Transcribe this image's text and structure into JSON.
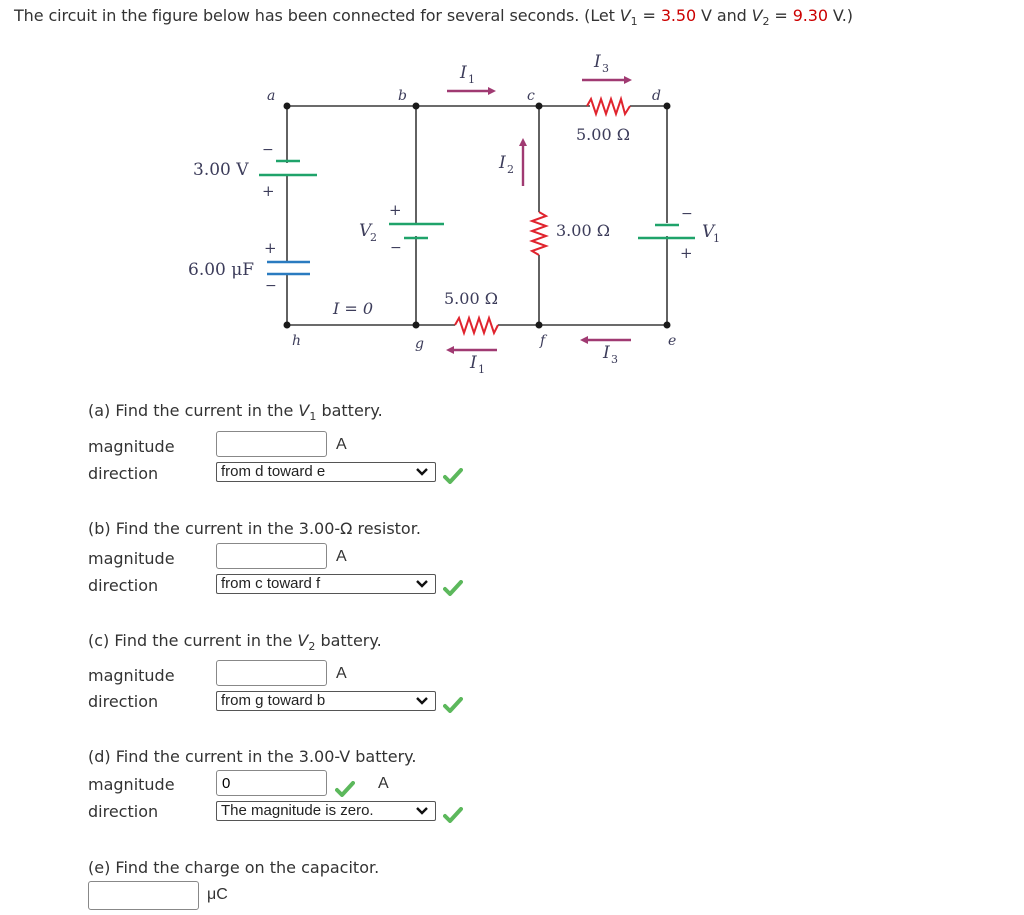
{
  "intro": {
    "text_before": "The circuit in the figure below has been connected for several seconds. (Let ",
    "v1_symbol": "V",
    "v1_sub": "1",
    "eq1": " = ",
    "v1_value": "3.50",
    "unit1": " V and ",
    "v2_symbol": "V",
    "v2_sub": "2",
    "eq2": " = ",
    "v2_value": "9.30",
    "unit2": " V.)"
  },
  "colors": {
    "given_value": "#cc0000",
    "wire": "#3a3a3a",
    "battery": "#1fa36a",
    "capacitor": "#2a7bc0",
    "resistor": "#e0242e",
    "current_arrow": "#a03a72",
    "check": "#5cb85c"
  },
  "circuit": {
    "nodes": [
      "a",
      "b",
      "c",
      "d",
      "e",
      "f",
      "g",
      "h"
    ],
    "battery_3v": "3.00 V",
    "capacitor": "6.00 μF",
    "v2_label": "V",
    "v2_sub": "2",
    "v1_label": "V",
    "v1_sub": "1",
    "r_top": "5.00 Ω",
    "r_middle": "3.00 Ω",
    "r_bottom": "5.00 Ω",
    "i_zero": "I = 0",
    "current_label": "I",
    "i1_sub": "1",
    "i2_sub": "2",
    "i3_sub": "3",
    "plus": "+",
    "minus": "−"
  },
  "questions": [
    {
      "prefix": "(a) Find the current in the ",
      "sym": "V",
      "sub": "1",
      "suffix": " battery.",
      "magnitude_label": "magnitude",
      "magnitude_value": "",
      "unit": "A",
      "direction_label": "direction",
      "direction_value": "from d toward e",
      "direction_correct": true
    },
    {
      "prefix": "(b) Find the current in the 3.00-Ω resistor.",
      "magnitude_label": "magnitude",
      "magnitude_value": "",
      "unit": "A",
      "direction_label": "direction",
      "direction_value": "from c toward f",
      "direction_correct": true
    },
    {
      "prefix": "(c) Find the current in the ",
      "sym": "V",
      "sub": "2",
      "suffix": " battery.",
      "magnitude_label": "magnitude",
      "magnitude_value": "",
      "unit": "A",
      "direction_label": "direction",
      "direction_value": "from g toward b",
      "direction_correct": true
    },
    {
      "prefix": "(d) Find the current in the 3.00-V battery.",
      "magnitude_label": "magnitude",
      "magnitude_value": "0",
      "magnitude_correct": true,
      "unit": "A",
      "direction_label": "direction",
      "direction_value": "The magnitude is zero.",
      "direction_correct": true
    },
    {
      "prefix": "(e) Find the charge on the capacitor.",
      "magnitude_value": "",
      "unit": "μC"
    }
  ]
}
